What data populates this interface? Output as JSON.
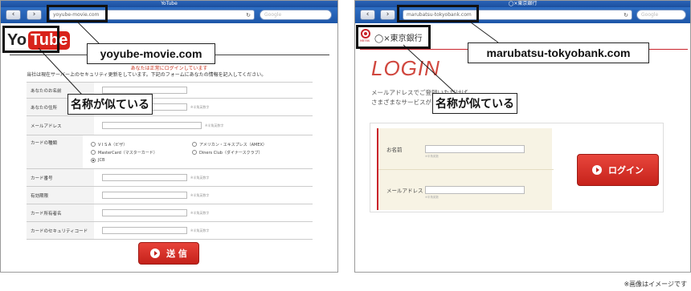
{
  "left": {
    "browser": {
      "title": "YoTube",
      "back_icon": "‹",
      "forward_icon": "›",
      "url": "yoyube-movie.com",
      "reload_icon": "↻",
      "search_placeholder": "Google"
    },
    "logo": {
      "part1": "Yo",
      "part2": "Tube"
    },
    "notice": "あなたは正常にログインしています",
    "instructions": "当社は現在サーバー上のセキュリティ更新をしています。下記のフォームにあなたの情報を記入してください。",
    "form": {
      "hint": "※半角英数字",
      "rows": [
        {
          "label": "あなたのお名前"
        },
        {
          "label": "あなたの住所"
        },
        {
          "label": "メールアドレス"
        },
        {
          "label": "カードの種類"
        },
        {
          "label": "カード番号"
        },
        {
          "label": "有効期限"
        },
        {
          "label": "カード所有者名"
        },
        {
          "label": "カードのセキュリティコード"
        }
      ],
      "card_types": [
        "V I S A（ビザ）",
        "アメリカン・エキスプレス（AMEX）",
        "MasterCard（マスターカード）",
        "Diners Club（ダイナースクラブ）",
        "JCB"
      ],
      "selected_card": "JCB",
      "submit_label": "送 信"
    },
    "callouts": {
      "domain": "yoyube-movie.com",
      "similar": "名称が似ている"
    }
  },
  "right": {
    "browser": {
      "title": "◯×東京銀行",
      "back_icon": "‹",
      "forward_icon": "›",
      "url": "marubatsu-tokyobank.com",
      "reload_icon": "↻",
      "search_placeholder": "Google"
    },
    "logo": {
      "name": "◯×東京銀行",
      "sub": "MBTBK"
    },
    "login_title": "LOGIN",
    "intro_line1": "メールアドレスでご登録いただけば",
    "intro_line2": "さまざまなサービスがご利用いただけます。",
    "fields": [
      {
        "label": "お名前",
        "hint": "※半角英数"
      },
      {
        "label": "メールアドレス",
        "hint": "※半角英数"
      }
    ],
    "login_button": "ログイン",
    "callouts": {
      "domain": "marubatsu-tokyobank.com",
      "similar": "名称が似ている"
    }
  },
  "footnote": "※画像はイメージです",
  "colors": {
    "accent_red": "#c9242b",
    "browser_blue": "#1d56a8",
    "panel_beige": "#f7f3e4"
  }
}
